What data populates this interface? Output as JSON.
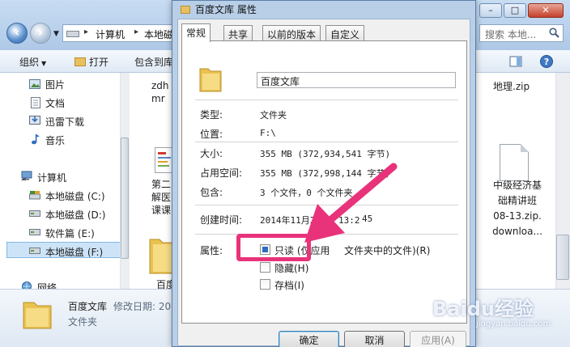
{
  "explorer": {
    "breadcrumb": [
      "计算机",
      "本地磁"
    ],
    "search_placeholder": "搜索 本地...",
    "toolbar": {
      "organize": "组织",
      "open": "打开",
      "include": "包含到库"
    },
    "nav": {
      "pictures": "图片",
      "documents": "文档",
      "thunder": "迅雷下载",
      "music": "音乐",
      "computer": "计算机",
      "drive_c": "本地磁盘 (C:)",
      "drive_d": "本地磁盘 (D:)",
      "drive_e": "软件篇 (E:)",
      "drive_f": "本地磁盘 (F:)",
      "network": "网络"
    },
    "files": {
      "partial_1_line1": "zdh",
      "partial_1_line2": "mr",
      "partial_2_line1": "第二",
      "partial_2_line2": "解医",
      "partial_2_line3": "课课",
      "partial_3": "百度",
      "zip_geo": "地理.zip",
      "zip_econ_1": "中级经济基",
      "zip_econ_2": "础精讲班",
      "zip_econ_3": "08-13.zip.",
      "zip_econ_4": "downloa..."
    },
    "details": {
      "name": "百度文库",
      "meta": "修改日期: 20",
      "type": "文件夹"
    }
  },
  "dialog": {
    "title": "百度文库 属性",
    "tabs": [
      "常规",
      "共享",
      "以前的版本",
      "自定义"
    ],
    "folder_name": "百度文库",
    "rows": {
      "type_label": "类型:",
      "type_value": "文件夹",
      "location_label": "位置:",
      "location_value": "F:\\",
      "size_label": "大小:",
      "size_value": "355 MB (372,934,541 字节)",
      "disk_label": "占用空间:",
      "disk_value": "355 MB (372,998,144 字节)",
      "contains_label": "包含:",
      "contains_value": "3 个文件，0 个文件夹",
      "created_label": "创建时间:",
      "created_value": "2014年11月28日，13:2",
      "created_value_tail": "45",
      "attrs_label": "属性:"
    },
    "attributes": {
      "readonly": "只读 (仅应用",
      "readonly_tail": "文件夹中的文件)(R)",
      "hidden": "隐藏(H)",
      "archive": "存档(I)"
    },
    "buttons": {
      "ok": "确定",
      "cancel": "取消",
      "apply": "应用(A)"
    }
  },
  "watermark": {
    "text": "Baidu经验",
    "sub": "jingyan.baidu.com"
  },
  "colors": {
    "highlight": "#e8337a",
    "selection": "#cde4f8",
    "folder": "#e8c060"
  }
}
